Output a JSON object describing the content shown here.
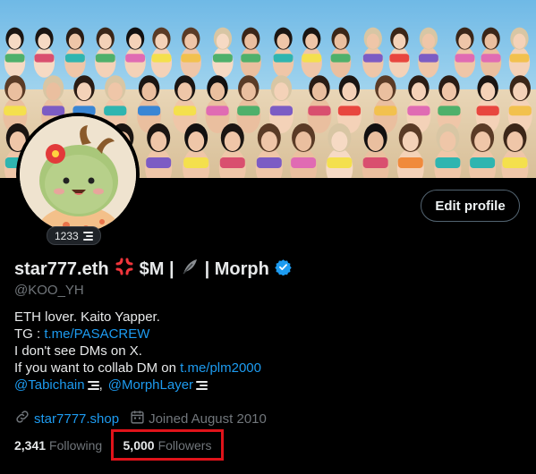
{
  "profile": {
    "display_name": "star777.eth",
    "name_tag_1": "$M |",
    "name_tag_2": "| Morph",
    "handle": "@KOO_YH",
    "edit_profile_label": "Edit profile",
    "badge_count": "1233",
    "icons": {
      "anger": "anger-symbol-icon",
      "feather": "feather-icon",
      "verified": "verified-badge-icon",
      "stack": "stack-logo-icon",
      "link": "link-icon",
      "calendar": "calendar-icon"
    }
  },
  "bio": {
    "line1": "ETH lover. Kaito Yapper.",
    "tg_label": "TG :",
    "tg_link": "t.me/PASACREW",
    "line3": "I don't see DMs on X.",
    "collab_text": "If you want to collab DM on",
    "collab_link": "t.me/plm2000",
    "mention1": "@Tabichain",
    "mention_separator": ",",
    "mention2": "@MorphLayer"
  },
  "meta": {
    "website": "star7777.shop",
    "joined": "Joined August 2010"
  },
  "stats": {
    "following_count": "2,341",
    "following_label": "Following",
    "followers_count": "5,000",
    "followers_label": "Followers"
  },
  "colors": {
    "accent": "#1d9bf0",
    "highlight_box": "#e0131a",
    "background": "#000000",
    "muted": "#71767b"
  }
}
